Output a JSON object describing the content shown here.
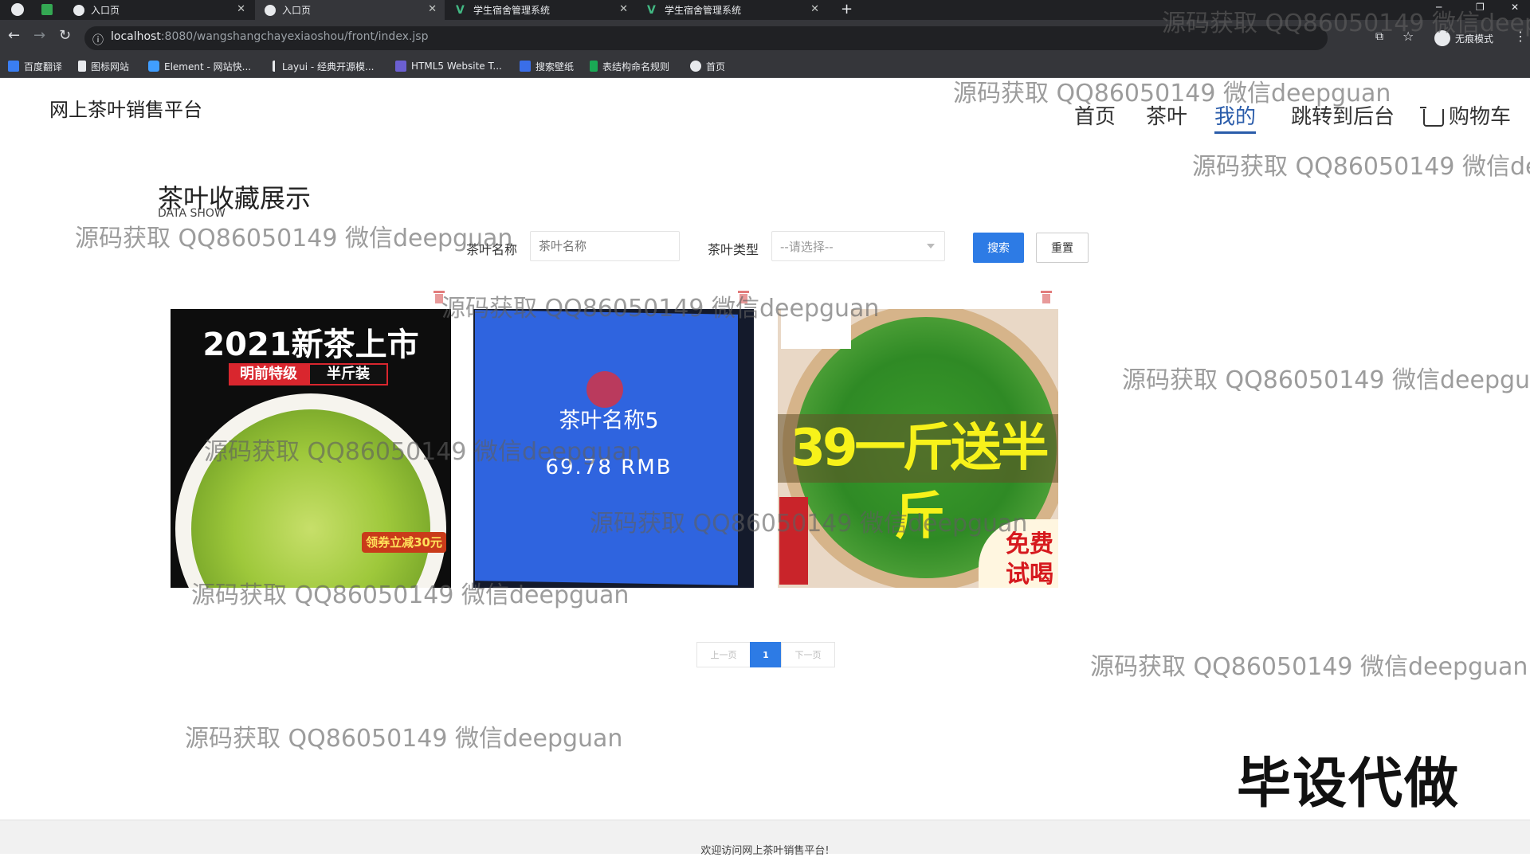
{
  "browser": {
    "tabs": [
      {
        "label": "入口页"
      },
      {
        "label": "入口页"
      },
      {
        "label": "学生宿舍管理系统"
      },
      {
        "label": "学生宿舍管理系统"
      }
    ],
    "url_host": "localhost",
    "url_rest": ":8080/wangshangchayexiaoshou/front/index.jsp",
    "incognito_label": "无痕模式",
    "bookmarks": [
      {
        "label": "百度翻译"
      },
      {
        "label": "图标网站"
      },
      {
        "label": "Element - 网站快..."
      },
      {
        "label": "Layui - 经典开源模..."
      },
      {
        "label": "HTML5 Website T..."
      },
      {
        "label": "搜索壁纸"
      },
      {
        "label": "表结构命名规则"
      },
      {
        "label": "首页"
      }
    ]
  },
  "site": {
    "brand": "网上茶叶销售平台",
    "nav": [
      {
        "label": "首页",
        "active": false
      },
      {
        "label": "茶叶",
        "active": false
      },
      {
        "label": "我的",
        "active": true
      },
      {
        "label": "跳转到后台",
        "active": false
      },
      {
        "label": "购物车",
        "active": false
      }
    ]
  },
  "section": {
    "title": "茶叶收藏展示",
    "subtitle": "DATA SHOW"
  },
  "filters": {
    "name_label": "茶叶名称",
    "name_placeholder": "茶叶名称",
    "type_label": "茶叶类型",
    "type_value": "--请选择--",
    "search_label": "搜索",
    "reset_label": "重置"
  },
  "products": [
    {
      "banner": "2021新茶上市",
      "tag1": "明前特级",
      "tag2": "半斤装",
      "coupon": "领券立减30元"
    },
    {
      "name": "茶叶名称5",
      "price": "69.78 RMB"
    },
    {
      "bigtext": "39一斤送半斤",
      "badge_line1": "免费",
      "badge_line2": "试喝"
    }
  ],
  "pagination": {
    "prev": "上一页",
    "current": "1",
    "next": "下一页"
  },
  "footer": {
    "text": "欢迎访问网上茶叶销售平台!"
  },
  "overlays": {
    "watermark": "源码获取 QQ86050149 微信deepguan",
    "watermark_cut1": "源码获取 QQ86050149 微信deep",
    "watermark_cut2": "源码获取 QQ86050149 微信de",
    "watermark_cut3": "源码获取 QQ86050149 微信deepgua",
    "big_text": "毕设代做"
  },
  "colors": {
    "accent": "#2d7be5",
    "nav_active": "#2a5caa"
  }
}
